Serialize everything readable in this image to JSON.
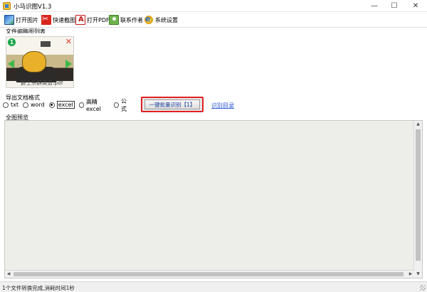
{
  "window": {
    "title": "小马识图V1.3",
    "controls": {
      "minimize": "—",
      "maximize": "☐",
      "close": "✕"
    }
  },
  "toolbar": {
    "items": [
      {
        "label": "打开图片",
        "icon": "open-image-icon"
      },
      {
        "label": "快速截图",
        "icon": "scissors-icon"
      },
      {
        "label": "打开PDF",
        "icon": "pdf-icon"
      },
      {
        "label": "联系作者",
        "icon": "contact-icon"
      },
      {
        "label": "系统设置",
        "icon": "settings-icon"
      }
    ]
  },
  "thumbnails": {
    "section_label": "文件缩略图列表",
    "items": [
      {
        "index": "1",
        "filename": "爵士乐群英谱.pdf",
        "delete_icon": "✕"
      }
    ]
  },
  "export": {
    "section_label": "导出文档格式",
    "options": [
      {
        "label": "txt",
        "selected": false
      },
      {
        "label": "word",
        "selected": false
      },
      {
        "label": "excel",
        "selected": true
      },
      {
        "label": "高精excel",
        "selected": false
      },
      {
        "label": "公式",
        "selected": false
      }
    ]
  },
  "actions": {
    "batch_ocr_label": "一键批量识别【1】",
    "ocr_directory_link": "识别目录",
    "highlight_color": "#e02020",
    "link_color": "#2a5bd7"
  },
  "preview": {
    "section_label": "全图预览",
    "background": "#ededea"
  },
  "status": {
    "text": "1个文件转换完成,消耗时间1秒"
  }
}
